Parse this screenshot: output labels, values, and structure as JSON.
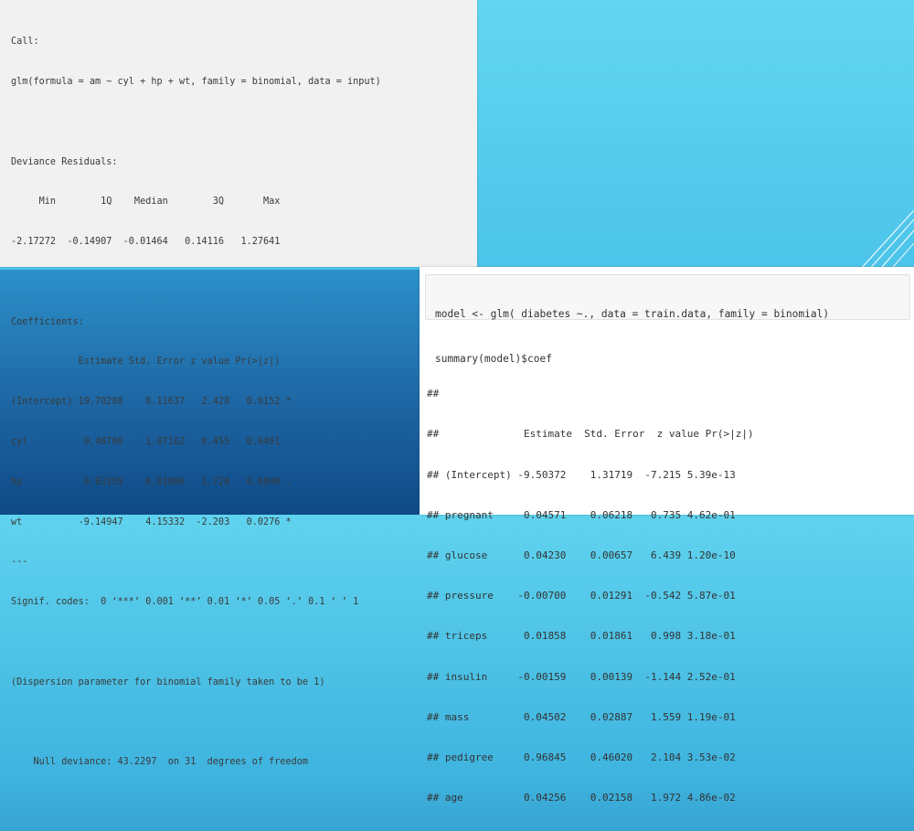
{
  "panel1": {
    "lines": [
      "Call:",
      "glm(formula = am ~ cyl + hp + wt, family = binomial, data = input)",
      "",
      "Deviance Residuals:",
      "     Min        1Q    Median        3Q       Max",
      "-2.17272  -0.14907  -0.01464   0.14116   1.27641",
      "",
      "Coefficients:",
      "            Estimate Std. Error z value Pr(>|z|)",
      "(Intercept) 19.70288    8.11637   2.428   0.0152 *",
      "cyl          0.48760    1.07162   0.455   0.6491",
      "hp           0.03259    0.01886   1.728   0.0840 .",
      "wt          -9.14947    4.15332  -2.203   0.0276 *",
      "---",
      "Signif. codes:  0 ‘***’ 0.001 ‘**’ 0.01 ‘*’ 0.05 ‘.’ 0.1 ‘ ’ 1",
      "",
      "(Dispersion parameter for binomial family taken to be 1)",
      "",
      "    Null deviance: 43.2297  on 31  degrees of freedom"
    ]
  },
  "panel2": {
    "code": [
      "model <- glm( diabetes ~., data = train.data, family = binomial)",
      "summary(model)$coef"
    ],
    "output": [
      "##",
      "##              Estimate  Std. Error  z value Pr(>|z|)",
      "## (Intercept) -9.50372    1.31719  -7.215 5.39e-13",
      "## pregnant     0.04571    0.06218   0.735 4.62e-01",
      "## glucose      0.04230    0.00657   6.439 1.20e-10",
      "## pressure    -0.00700    0.01291  -0.542 5.87e-01",
      "## triceps      0.01858    0.01861   0.998 3.18e-01",
      "## insulin     -0.00159    0.00139  -1.144 2.52e-01",
      "## mass         0.04502    0.02887   1.559 1.19e-01",
      "## pedigree     0.96845    0.46020   2.104 3.53e-02",
      "## age          0.04256    0.02158   1.972 4.86e-02"
    ]
  }
}
